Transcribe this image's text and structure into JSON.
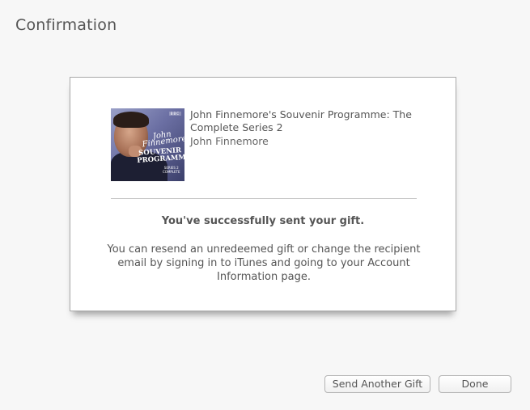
{
  "page": {
    "title": "Confirmation"
  },
  "gift": {
    "item_title": "John Finnemore's Souvenir Programme: The Complete Series 2",
    "item_author": "John Finnemore",
    "cover": {
      "script_text": "John Finnemore's",
      "title_text": "SOUVENIR PROGRAMME",
      "series_text": "SERIES 2",
      "complete_text": "COMPLETE",
      "badge_text": "BBC"
    },
    "success_message": "You've successfully sent your gift.",
    "info_message": "You can resend an unredeemed gift or change the recipient email by signing in to iTunes and going to your Account Information page."
  },
  "actions": {
    "send_another_label": "Send Another Gift",
    "done_label": "Done"
  }
}
